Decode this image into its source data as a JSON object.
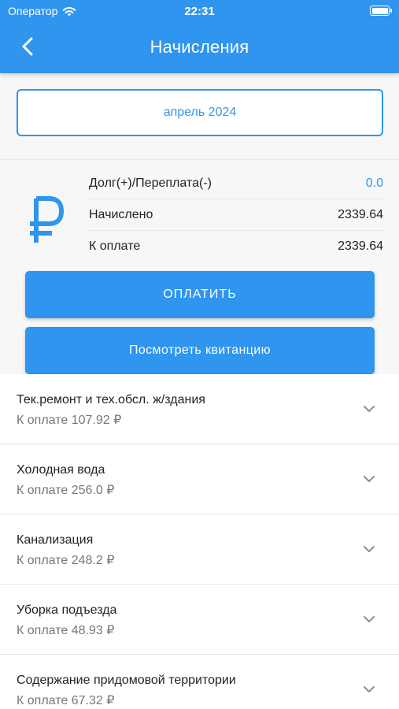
{
  "status_bar": {
    "carrier": "Оператор",
    "time": "22:31"
  },
  "header": {
    "title": "Начисления",
    "back_icon": "chevron-left-icon"
  },
  "period": {
    "label": "апрель 2024"
  },
  "summary": {
    "currency_icon": "ruble-icon",
    "rows": [
      {
        "label": "Долг(+)/Переплата(-)",
        "value": "0.0"
      },
      {
        "label": "Начислено",
        "value": "2339.64"
      },
      {
        "label": "К оплате",
        "value": "2339.64"
      }
    ],
    "pay_button": "Оплатить",
    "receipt_button": "Посмотреть квитанцию"
  },
  "charges": [
    {
      "name": "Тек.ремонт и тех.обсл. ж/здания",
      "amount": "К оплате 107.92 ₽"
    },
    {
      "name": "Холодная вода",
      "amount": "К оплате 256.0 ₽"
    },
    {
      "name": "Канализация",
      "amount": "К оплате 248.2 ₽"
    },
    {
      "name": "Уборка подъезда",
      "amount": "К оплате 48.93 ₽"
    },
    {
      "name": "Содержание придомовой территории",
      "amount": "К оплате 67.32 ₽"
    }
  ],
  "colors": {
    "accent": "#2f95ef",
    "background": "#f7f7f8"
  }
}
